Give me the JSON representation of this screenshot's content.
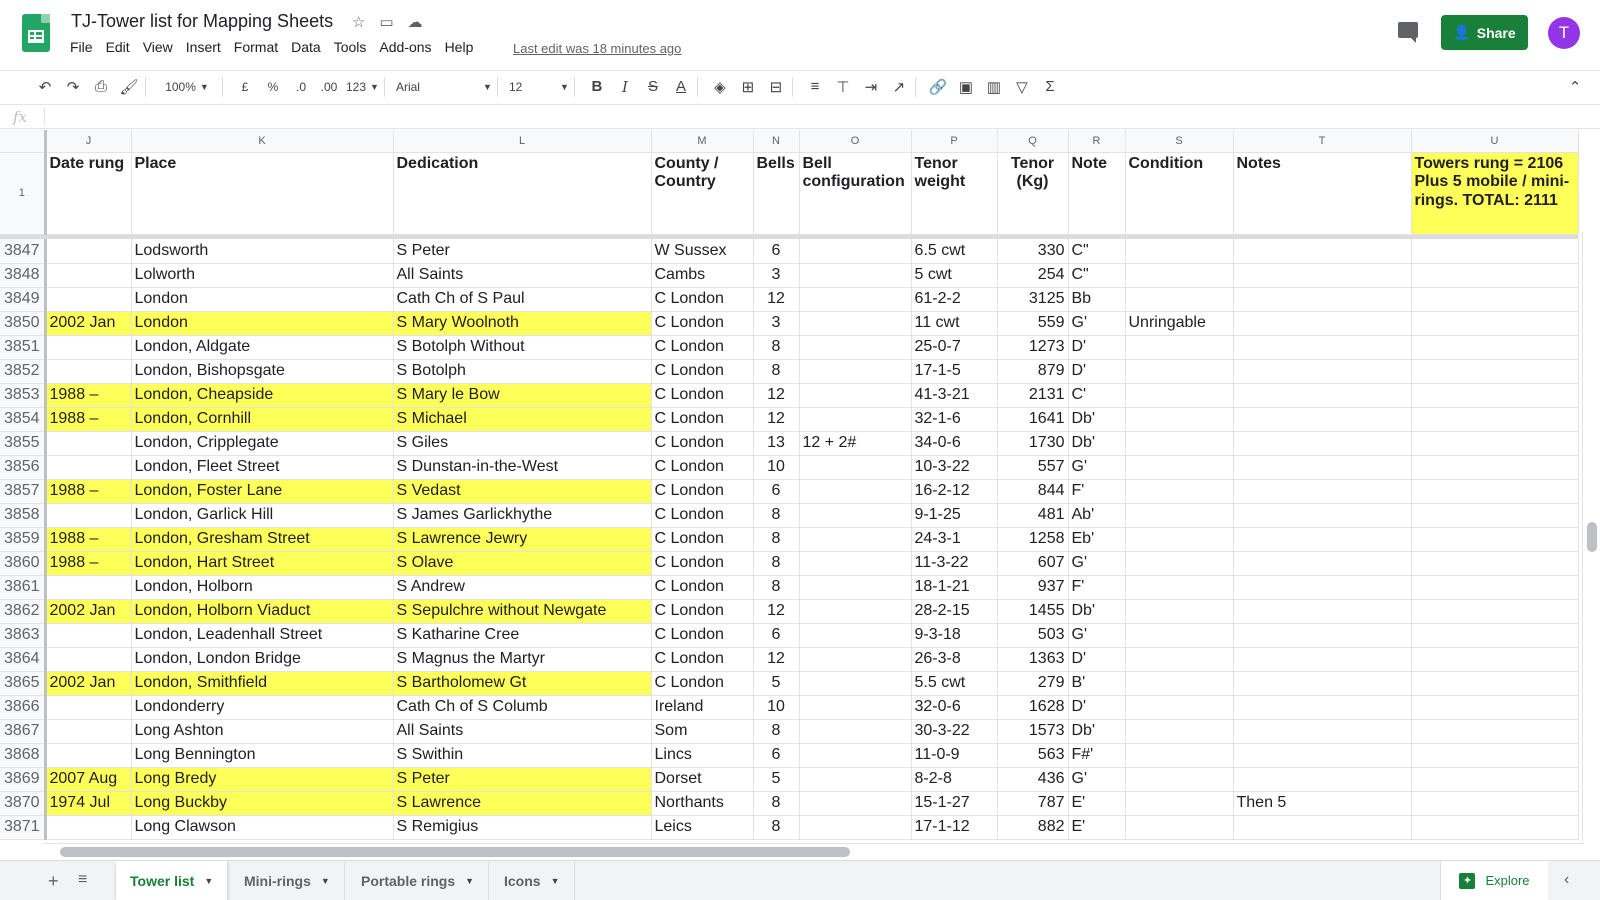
{
  "app": {
    "doc_title": "TJ-Tower list for Mapping Sheets",
    "menu": [
      "File",
      "Edit",
      "View",
      "Insert",
      "Format",
      "Data",
      "Tools",
      "Add-ons",
      "Help"
    ],
    "last_edit": "Last edit was 18 minutes ago",
    "share_label": "Share",
    "avatar_initial": "T"
  },
  "toolbar": {
    "zoom": "100%",
    "currency": "£",
    "percent": "%",
    "dec_less": ".0",
    "dec_more": ".00",
    "format_more": "123",
    "font": "Arial",
    "font_size": "12",
    "bold": "B",
    "italic": "I",
    "strike": "S",
    "text_color": "A",
    "sum": "Σ"
  },
  "formula_bar": {
    "fx": "fx"
  },
  "grid": {
    "columns": [
      "J",
      "K",
      "L",
      "M",
      "N",
      "O",
      "P",
      "Q",
      "R",
      "S",
      "T",
      "U"
    ],
    "header_row_num": "1",
    "header": {
      "date": "Date rung",
      "place": "Place",
      "dedication": "Dedication",
      "county": "County / Country",
      "bells": "Bells",
      "config": "Bell configuration",
      "tenor_weight": "Tenor weight",
      "tenor_kg": "Tenor (Kg)",
      "note": "Note",
      "condition": "Condition",
      "notes": "Notes",
      "total": "Towers rung = 2106 Plus 5 mobile / mini-rings. TOTAL: 2111"
    },
    "rows": [
      {
        "n": "3847",
        "date": "",
        "place": "Lodsworth",
        "ded": "S Peter",
        "county": "W Sussex",
        "bells": "6",
        "config": "",
        "tw": "6.5 cwt",
        "kg": "330",
        "note": "C\"",
        "cond": "",
        "notes": "",
        "hl": false
      },
      {
        "n": "3848",
        "date": "",
        "place": "Lolworth",
        "ded": "All Saints",
        "county": "Cambs",
        "bells": "3",
        "config": "",
        "tw": "5 cwt",
        "kg": "254",
        "note": "C\"",
        "cond": "",
        "notes": "",
        "hl": false
      },
      {
        "n": "3849",
        "date": "",
        "place": "London",
        "ded": "Cath Ch of S Paul",
        "county": "C London",
        "bells": "12",
        "config": "",
        "tw": "61-2-2",
        "kg": "3125",
        "note": "Bb",
        "cond": "",
        "notes": "",
        "hl": false
      },
      {
        "n": "3850",
        "date": "2002 Jan",
        "place": "London",
        "ded": "S Mary Woolnoth",
        "county": "C London",
        "bells": "3",
        "config": "",
        "tw": "11 cwt",
        "kg": "559",
        "note": "G'",
        "cond": "Unringable",
        "notes": "",
        "hl": true
      },
      {
        "n": "3851",
        "date": "",
        "place": "London, Aldgate",
        "ded": "S Botolph Without",
        "county": "C London",
        "bells": "8",
        "config": "",
        "tw": "25-0-7",
        "kg": "1273",
        "note": "D'",
        "cond": "",
        "notes": "",
        "hl": false
      },
      {
        "n": "3852",
        "date": "",
        "place": "London, Bishopsgate",
        "ded": "S Botolph",
        "county": "C London",
        "bells": "8",
        "config": "",
        "tw": "17-1-5",
        "kg": "879",
        "note": "D'",
        "cond": "",
        "notes": "",
        "hl": false
      },
      {
        "n": "3853",
        "date": "1988 –",
        "place": "London, Cheapside",
        "ded": "S Mary le Bow",
        "county": "C London",
        "bells": "12",
        "config": "",
        "tw": "41-3-21",
        "kg": "2131",
        "note": "C'",
        "cond": "",
        "notes": "",
        "hl": true
      },
      {
        "n": "3854",
        "date": "1988 –",
        "place": "London, Cornhill",
        "ded": "S Michael",
        "county": "C London",
        "bells": "12",
        "config": "",
        "tw": "32-1-6",
        "kg": "1641",
        "note": "Db'",
        "cond": "",
        "notes": "",
        "hl": true
      },
      {
        "n": "3855",
        "date": "",
        "place": "London, Cripplegate",
        "ded": "S Giles",
        "county": "C London",
        "bells": "13",
        "config": "12 + 2#",
        "tw": "34-0-6",
        "kg": "1730",
        "note": "Db'",
        "cond": "",
        "notes": "",
        "hl": false
      },
      {
        "n": "3856",
        "date": "",
        "place": "London, Fleet Street",
        "ded": "S Dunstan-in-the-West",
        "county": "C London",
        "bells": "10",
        "config": "",
        "tw": "10-3-22",
        "kg": "557",
        "note": "G'",
        "cond": "",
        "notes": "",
        "hl": false
      },
      {
        "n": "3857",
        "date": "1988 –",
        "place": "London, Foster Lane",
        "ded": "S Vedast",
        "county": "C London",
        "bells": "6",
        "config": "",
        "tw": "16-2-12",
        "kg": "844",
        "note": "F'",
        "cond": "",
        "notes": "",
        "hl": true
      },
      {
        "n": "3858",
        "date": "",
        "place": "London, Garlick Hill",
        "ded": "S James Garlickhythe",
        "county": "C London",
        "bells": "8",
        "config": "",
        "tw": "9-1-25",
        "kg": "481",
        "note": "Ab'",
        "cond": "",
        "notes": "",
        "hl": false
      },
      {
        "n": "3859",
        "date": "1988 –",
        "place": "London, Gresham Street",
        "ded": "S Lawrence Jewry",
        "county": "C London",
        "bells": "8",
        "config": "",
        "tw": "24-3-1",
        "kg": "1258",
        "note": "Eb'",
        "cond": "",
        "notes": "",
        "hl": true
      },
      {
        "n": "3860",
        "date": "1988 –",
        "place": "London, Hart Street",
        "ded": "S Olave",
        "county": "C London",
        "bells": "8",
        "config": "",
        "tw": "11-3-22",
        "kg": "607",
        "note": "G'",
        "cond": "",
        "notes": "",
        "hl": true
      },
      {
        "n": "3861",
        "date": "",
        "place": "London, Holborn",
        "ded": "S Andrew",
        "county": "C London",
        "bells": "8",
        "config": "",
        "tw": "18-1-21",
        "kg": "937",
        "note": "F'",
        "cond": "",
        "notes": "",
        "hl": false
      },
      {
        "n": "3862",
        "date": "2002 Jan",
        "place": "London, Holborn Viaduct",
        "ded": "S Sepulchre without Newgate",
        "county": "C London",
        "bells": "12",
        "config": "",
        "tw": "28-2-15",
        "kg": "1455",
        "note": "Db'",
        "cond": "",
        "notes": "",
        "hl": true
      },
      {
        "n": "3863",
        "date": "",
        "place": "London, Leadenhall Street",
        "ded": "S Katharine Cree",
        "county": "C London",
        "bells": "6",
        "config": "",
        "tw": "9-3-18",
        "kg": "503",
        "note": "G'",
        "cond": "",
        "notes": "",
        "hl": false
      },
      {
        "n": "3864",
        "date": "",
        "place": "London, London Bridge",
        "ded": "S Magnus the Martyr",
        "county": "C London",
        "bells": "12",
        "config": "",
        "tw": "26-3-8",
        "kg": "1363",
        "note": "D'",
        "cond": "",
        "notes": "",
        "hl": false
      },
      {
        "n": "3865",
        "date": "2002 Jan",
        "place": "London, Smithfield",
        "ded": "S Bartholomew Gt",
        "county": "C London",
        "bells": "5",
        "config": "",
        "tw": "5.5 cwt",
        "kg": "279",
        "note": "B'",
        "cond": "",
        "notes": "",
        "hl": true
      },
      {
        "n": "3866",
        "date": "",
        "place": "Londonderry",
        "ded": "Cath Ch of S Columb",
        "county": "Ireland",
        "bells": "10",
        "config": "",
        "tw": "32-0-6",
        "kg": "1628",
        "note": "D'",
        "cond": "",
        "notes": "",
        "hl": false
      },
      {
        "n": "3867",
        "date": "",
        "place": "Long Ashton",
        "ded": "All Saints",
        "county": "Som",
        "bells": "8",
        "config": "",
        "tw": "30-3-22",
        "kg": "1573",
        "note": "Db'",
        "cond": "",
        "notes": "",
        "hl": false
      },
      {
        "n": "3868",
        "date": "",
        "place": "Long Bennington",
        "ded": "S Swithin",
        "county": "Lincs",
        "bells": "6",
        "config": "",
        "tw": "11-0-9",
        "kg": "563",
        "note": "F#'",
        "cond": "",
        "notes": "",
        "hl": false
      },
      {
        "n": "3869",
        "date": "2007 Aug",
        "place": "Long Bredy",
        "ded": "S Peter",
        "county": "Dorset",
        "bells": "5",
        "config": "",
        "tw": "8-2-8",
        "kg": "436",
        "note": "G'",
        "cond": "",
        "notes": "",
        "hl": true
      },
      {
        "n": "3870",
        "date": "1974 Jul",
        "place": "Long Buckby",
        "ded": "S Lawrence",
        "county": "Northants",
        "bells": "8",
        "config": "",
        "tw": "15-1-27",
        "kg": "787",
        "note": "E'",
        "cond": "",
        "notes": "Then 5",
        "hl": true
      },
      {
        "n": "3871",
        "date": "",
        "place": "Long Clawson",
        "ded": "S Remigius",
        "county": "Leics",
        "bells": "8",
        "config": "",
        "tw": "17-1-12",
        "kg": "882",
        "note": "E'",
        "cond": "",
        "notes": "",
        "hl": false
      }
    ]
  },
  "tabs": {
    "sheets": [
      "Tower list",
      "Mini-rings",
      "Portable rings",
      "Icons"
    ],
    "active": 0,
    "explore_label": "Explore"
  },
  "colors": {
    "highlight": "#ffff5a",
    "share": "#188038",
    "avatar": "#9334e6",
    "sheets_green": "#23a566"
  }
}
